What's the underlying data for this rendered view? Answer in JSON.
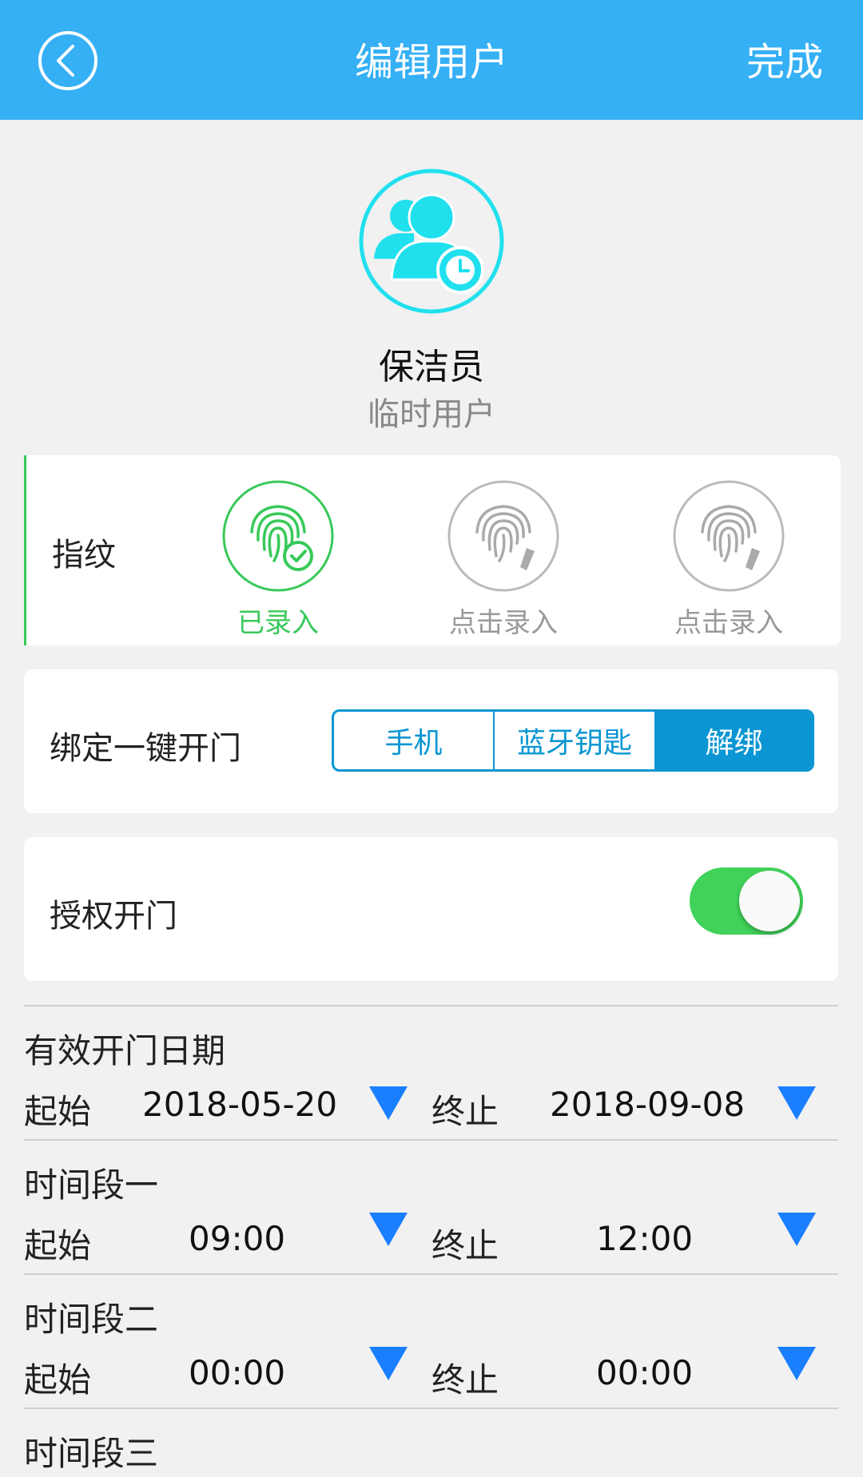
{
  "header": {
    "title": "编辑用户",
    "done_label": "完成",
    "back_icon": "back-arrow-icon"
  },
  "user": {
    "name": "保洁员",
    "type": "临时用户",
    "avatar_icon": "temporary-user-icon",
    "avatar_color": "#20e0ee"
  },
  "fingerprint": {
    "label": "指纹",
    "slots": [
      {
        "status": "已录入",
        "icon": "fingerprint-check-icon",
        "color": "#38c95a"
      },
      {
        "status": "点击录入",
        "icon": "fingerprint-edit-icon",
        "color": "#aaaaaa"
      },
      {
        "status": "点击录入",
        "icon": "fingerprint-edit-icon",
        "color": "#aaaaaa"
      }
    ]
  },
  "bind": {
    "label": "绑定一键开门",
    "options": [
      "手机",
      "蓝牙钥匙",
      "解绑"
    ],
    "selected": "解绑"
  },
  "authorize": {
    "label": "授权开门",
    "enabled": true
  },
  "valid_date": {
    "title": "有效开门日期",
    "start_label": "起始",
    "start": "2018-05-20",
    "end_label": "终止",
    "end": "2018-09-08"
  },
  "periods": [
    {
      "title": "时间段一",
      "start_label": "起始",
      "start": "09:00",
      "end_label": "终止",
      "end": "12:00"
    },
    {
      "title": "时间段二",
      "start_label": "起始",
      "start": "00:00",
      "end_label": "终止",
      "end": "00:00"
    },
    {
      "title": "时间段三"
    }
  ],
  "colors": {
    "header": "#35b0f5",
    "accent_blue": "#0b96d3",
    "dropdown": "#1a7fff",
    "toggle_on": "#40d259"
  }
}
